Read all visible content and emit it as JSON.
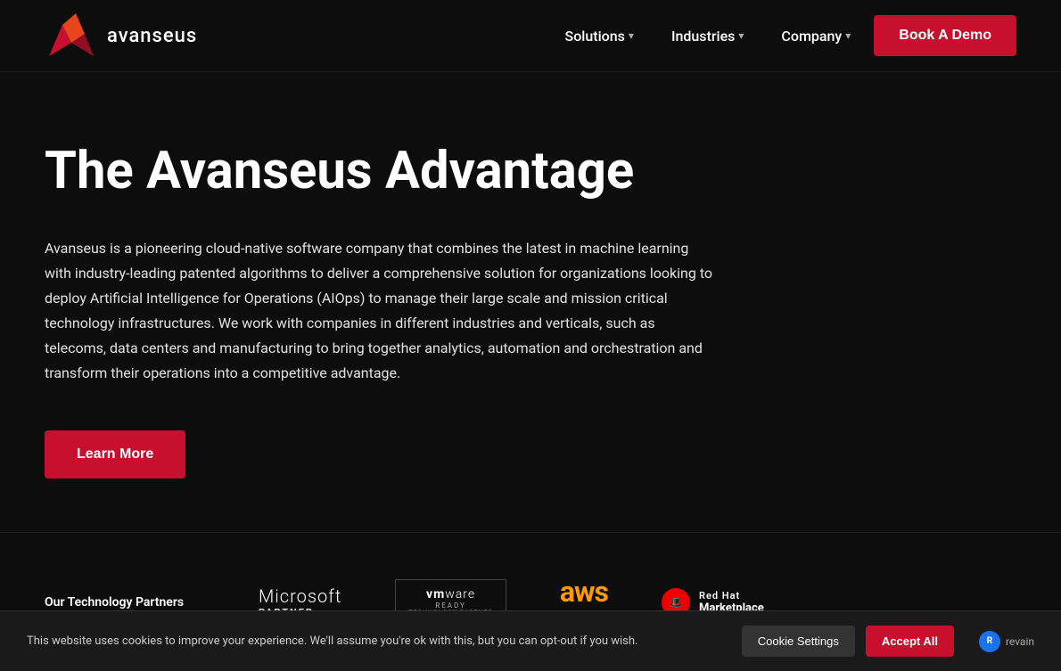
{
  "brand": {
    "name": "avanseus",
    "logo_alt": "Avanseus Logo"
  },
  "navbar": {
    "solutions_label": "Solutions",
    "industries_label": "Industries",
    "company_label": "Company",
    "book_demo_label": "Book A Demo"
  },
  "hero": {
    "title": "The Avanseus Advantage",
    "description": "Avanseus is a pioneering cloud-native software company that combines the latest in machine learning with industry-leading patented algorithms to deliver a comprehensive solution for organizations looking to deploy Artificial Intelligence for Operations (AIOps) to manage their large scale and mission critical technology infrastructures. We work with companies in different industries and verticals, such as telecoms, data centers and manufacturing to bring together analytics, automation and orchestration and transform their operations into a competitive advantage.",
    "learn_more_label": "Learn More"
  },
  "partners": {
    "section_label": "Our Technology Partners",
    "logos": [
      {
        "name": "Microsoft Partner",
        "line1": "Microsoft",
        "line2": "Partner"
      },
      {
        "name": "VMware Ready",
        "brand": "vmware",
        "ready": "READY",
        "sub": "Technology Partner"
      },
      {
        "name": "AWS",
        "text": "aws"
      },
      {
        "name": "Red Hat Marketplace",
        "brand": "Red Hat",
        "marketplace": "Marketplace"
      }
    ]
  },
  "cookie": {
    "text": "This website uses cookies to improve your experience. We'll assume you're ok with this, but you can opt-out if you wish.",
    "settings_label": "Cookie Settings",
    "accept_label": "Accept All",
    "revain_label": "revain"
  },
  "colors": {
    "accent_red": "#c8102e",
    "background": "#0d0d0d",
    "text_primary": "#ffffff",
    "text_secondary": "#e0e0e0",
    "aws_orange": "#ff9900"
  }
}
